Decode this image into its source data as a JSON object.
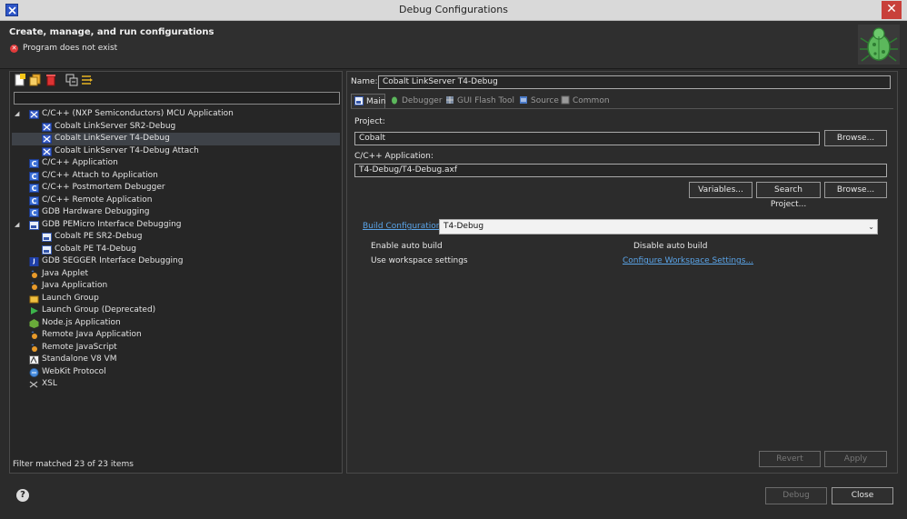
{
  "window": {
    "title": "Debug Configurations",
    "close_glyph": "✕"
  },
  "header": {
    "title": "Create, manage, and run configurations",
    "error_message": "Program does not exist",
    "error_glyph": "✕"
  },
  "left": {
    "filter_value": "",
    "tree": [
      {
        "id": "mcu",
        "label": "C/C++ (NXP Semiconductors) MCU Application",
        "level": 0,
        "expanded": true,
        "icon": "c-launch-icon"
      },
      {
        "id": "sr2",
        "label": "Cobalt LinkServer SR2-Debug",
        "level": 1,
        "icon": "c-launch-icon"
      },
      {
        "id": "t4",
        "label": "Cobalt LinkServer T4-Debug",
        "level": 1,
        "icon": "c-launch-icon",
        "selected": true
      },
      {
        "id": "t4a",
        "label": "Cobalt LinkServer T4-Debug Attach",
        "level": 1,
        "icon": "c-launch-icon"
      },
      {
        "id": "capp",
        "label": "C/C++ Application",
        "level": 0,
        "icon": "c-app-icon"
      },
      {
        "id": "cattach",
        "label": "C/C++ Attach to Application",
        "level": 0,
        "icon": "c-app-icon"
      },
      {
        "id": "cpm",
        "label": "C/C++ Postmortem Debugger",
        "level": 0,
        "icon": "c-app-icon"
      },
      {
        "id": "cremote",
        "label": "C/C++ Remote Application",
        "level": 0,
        "icon": "c-app-icon"
      },
      {
        "id": "gdbhw",
        "label": "GDB Hardware Debugging",
        "level": 0,
        "icon": "c-app-icon"
      },
      {
        "id": "pemicro",
        "label": "GDB PEMicro Interface Debugging",
        "level": 0,
        "expanded": true,
        "icon": "pe-icon"
      },
      {
        "id": "pesr2",
        "label": "Cobalt PE SR2-Debug",
        "level": 1,
        "icon": "pe-icon"
      },
      {
        "id": "pet4",
        "label": "Cobalt PE T4-Debug",
        "level": 1,
        "icon": "pe-icon"
      },
      {
        "id": "segger",
        "label": "GDB SEGGER Interface Debugging",
        "level": 0,
        "icon": "jlink-icon"
      },
      {
        "id": "japplet",
        "label": "Java Applet",
        "level": 0,
        "icon": "java-icon"
      },
      {
        "id": "japp",
        "label": "Java Application",
        "level": 0,
        "icon": "java-icon"
      },
      {
        "id": "lgroup",
        "label": "Launch Group",
        "level": 0,
        "icon": "launch-group-icon"
      },
      {
        "id": "lgroupd",
        "label": "Launch Group (Deprecated)",
        "level": 0,
        "icon": "play-icon"
      },
      {
        "id": "node",
        "label": "Node.js Application",
        "level": 0,
        "icon": "nodejs-icon"
      },
      {
        "id": "rjava",
        "label": "Remote Java Application",
        "level": 0,
        "icon": "java-icon"
      },
      {
        "id": "rjs",
        "label": "Remote JavaScript",
        "level": 0,
        "icon": "js-icon"
      },
      {
        "id": "v8",
        "label": "Standalone V8 VM",
        "level": 0,
        "icon": "v8-icon"
      },
      {
        "id": "webkit",
        "label": "WebKit Protocol",
        "level": 0,
        "icon": "webkit-icon"
      },
      {
        "id": "xsl",
        "label": "XSL",
        "level": 0,
        "icon": "xsl-icon"
      }
    ],
    "filter_status": "Filter matched 23 of 23 items"
  },
  "right": {
    "name_label": "Name:",
    "name_value": "Cobalt LinkServer T4-Debug",
    "tabs": [
      {
        "label": "Main",
        "icon": "main-tab-icon",
        "active": true
      },
      {
        "label": "Debugger",
        "icon": "debugger-tab-icon"
      },
      {
        "label": "GUI Flash Tool",
        "icon": "flash-tool-tab-icon"
      },
      {
        "label": "Source",
        "icon": "source-tab-icon"
      },
      {
        "label": "Common",
        "icon": "common-tab-icon"
      }
    ],
    "project_label": "Project:",
    "project_value": "Cobalt",
    "browse_label": "Browse...",
    "app_label": "C/C++ Application:",
    "app_value": "T4-Debug/T4-Debug.axf",
    "variables_label": "Variables...",
    "search_project_label": "Search Project...",
    "browse2_label": "Browse...",
    "build_config_label": "Build Configuration:",
    "build_config_value": "T4-Debug",
    "enable_auto_build": "Enable auto build",
    "disable_auto_build": "Disable auto build",
    "use_workspace": "Use workspace settings",
    "configure_workspace": "Configure Workspace Settings...",
    "revert_label": "Revert",
    "apply_label": "Apply"
  },
  "footer": {
    "help_glyph": "?",
    "debug_label": "Debug",
    "close_label": "Close"
  }
}
